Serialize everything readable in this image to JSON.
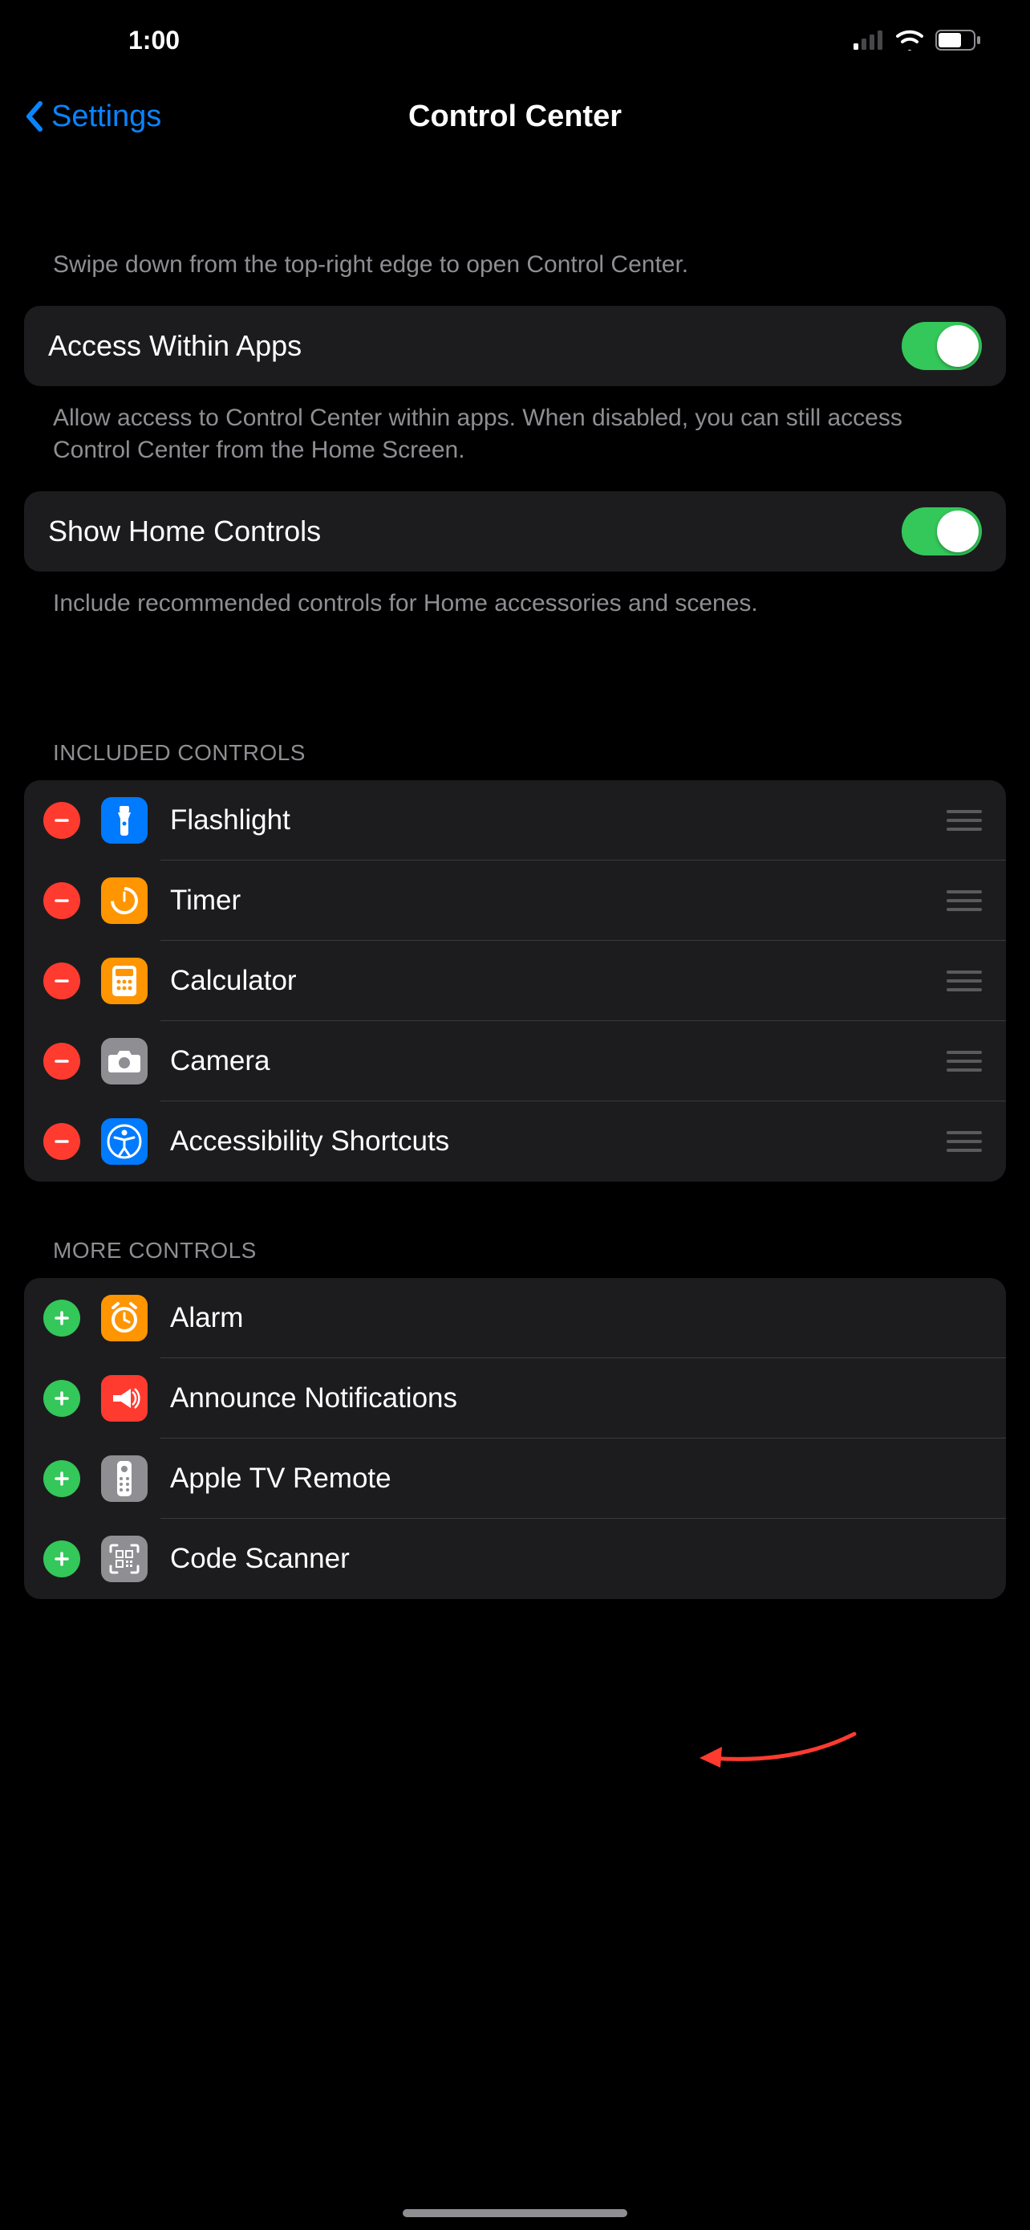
{
  "status": {
    "time": "1:00"
  },
  "nav": {
    "back": "Settings",
    "title": "Control Center"
  },
  "intro": "Swipe down from the top-right edge to open Control Center.",
  "toggles": {
    "access": {
      "label": "Access Within Apps",
      "desc": "Allow access to Control Center within apps. When disabled, you can still access Control Center from the Home Screen.",
      "on": true
    },
    "home": {
      "label": "Show Home Controls",
      "desc": "Include recommended controls for Home accessories and scenes.",
      "on": true
    }
  },
  "sections": {
    "included": {
      "header": "INCLUDED CONTROLS",
      "items": [
        {
          "label": "Flashlight",
          "icon": "flashlight",
          "bg": "#007aff"
        },
        {
          "label": "Timer",
          "icon": "timer",
          "bg": "#ff9500"
        },
        {
          "label": "Calculator",
          "icon": "calculator",
          "bg": "#ff9500"
        },
        {
          "label": "Camera",
          "icon": "camera",
          "bg": "#8e8e93"
        },
        {
          "label": "Accessibility Shortcuts",
          "icon": "accessibility",
          "bg": "#007aff"
        }
      ]
    },
    "more": {
      "header": "MORE CONTROLS",
      "items": [
        {
          "label": "Alarm",
          "icon": "alarm",
          "bg": "#ff9500"
        },
        {
          "label": "Announce Notifications",
          "icon": "announce",
          "bg": "#ff3b30"
        },
        {
          "label": "Apple TV Remote",
          "icon": "tvremote",
          "bg": "#8e8e93"
        },
        {
          "label": "Code Scanner",
          "icon": "qrcode",
          "bg": "#8e8e93"
        }
      ]
    }
  },
  "colors": {
    "accent": "#0a84ff",
    "toggleOn": "#34c759",
    "remove": "#ff3b30",
    "add": "#34c759",
    "annotationArrow": "#ff3b30"
  }
}
